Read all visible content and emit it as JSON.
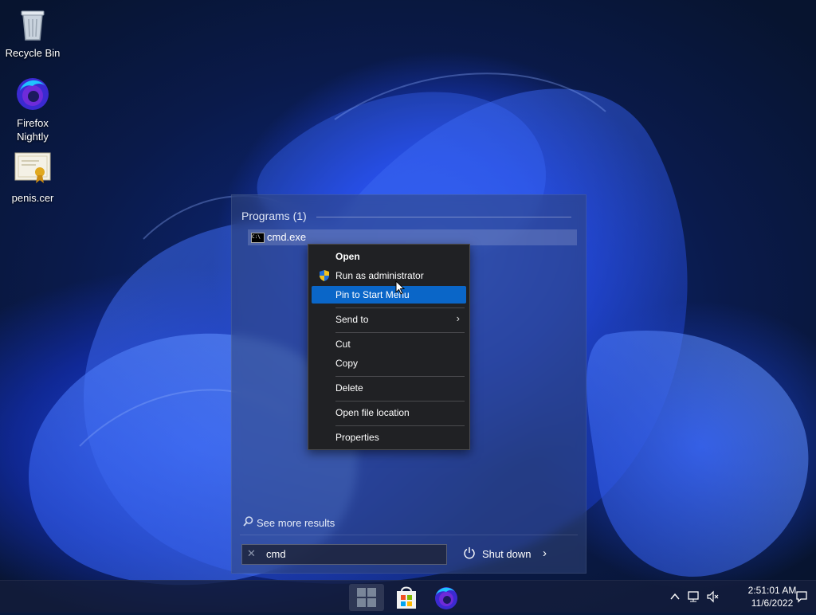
{
  "desktop": {
    "icons": [
      {
        "label": "Recycle Bin",
        "icon": "recycle-bin-icon"
      },
      {
        "label": "Firefox\nNightly",
        "icon": "firefox-nightly-icon"
      },
      {
        "label": "penis.cer",
        "icon": "certificate-icon"
      }
    ]
  },
  "start_panel": {
    "programs_header": "Programs (1)",
    "result": {
      "label": "cmd.exe",
      "icon": "command-prompt-icon"
    },
    "see_more": "See more results",
    "search": {
      "value": "cmd"
    },
    "shutdown": {
      "label": "Shut down"
    }
  },
  "context_menu": {
    "items": [
      {
        "label": "Open",
        "bold": true
      },
      {
        "label": "Run as administrator",
        "icon": "uac-shield-icon"
      },
      {
        "label": "Pin to Start Menu",
        "highlighted": true
      },
      {
        "label": "Send to",
        "submenu": true
      },
      {
        "label": "Cut"
      },
      {
        "label": "Copy"
      },
      {
        "label": "Delete"
      },
      {
        "label": "Open file location"
      },
      {
        "label": "Properties"
      }
    ]
  },
  "taskbar": {
    "apps": [
      {
        "name": "start-button",
        "icon": "start-icon"
      },
      {
        "name": "microsoft-store",
        "icon": "store-icon"
      },
      {
        "name": "firefox",
        "icon": "firefox-icon"
      }
    ],
    "clock": {
      "time": "2:51:01 AM",
      "date": "11/6/2022"
    }
  },
  "colors": {
    "menu_bg": "#202124",
    "menu_highlight": "#0a66c8",
    "accent_blue": "#1c3ed8"
  }
}
